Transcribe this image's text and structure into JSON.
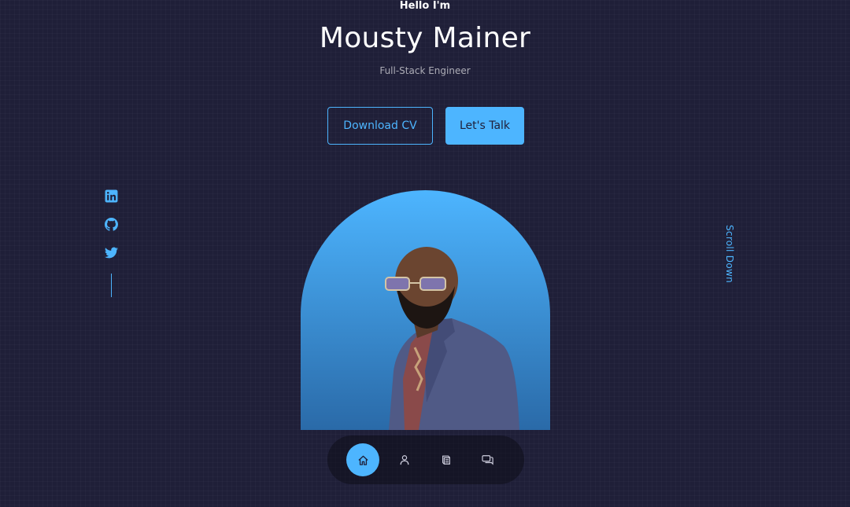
{
  "hero": {
    "greeting": "Hello I'm",
    "name": "Mousty Mainer",
    "role": "Full-Stack Engineer"
  },
  "cta": {
    "download_label": "Download CV",
    "talk_label": "Let's Talk"
  },
  "socials": [
    {
      "icon": "linkedin-icon"
    },
    {
      "icon": "github-icon"
    },
    {
      "icon": "twitter-icon"
    }
  ],
  "scroll": {
    "label": "Scroll Down"
  },
  "nav": {
    "items": [
      {
        "icon": "home-icon",
        "active": true
      },
      {
        "icon": "user-icon",
        "active": false
      },
      {
        "icon": "book-icon",
        "active": false
      },
      {
        "icon": "message-icon",
        "active": false
      }
    ]
  },
  "colors": {
    "background": "#1f1f38",
    "primary": "#4db5ff",
    "text": "#ffffff",
    "muted": "#a6a6b8"
  }
}
